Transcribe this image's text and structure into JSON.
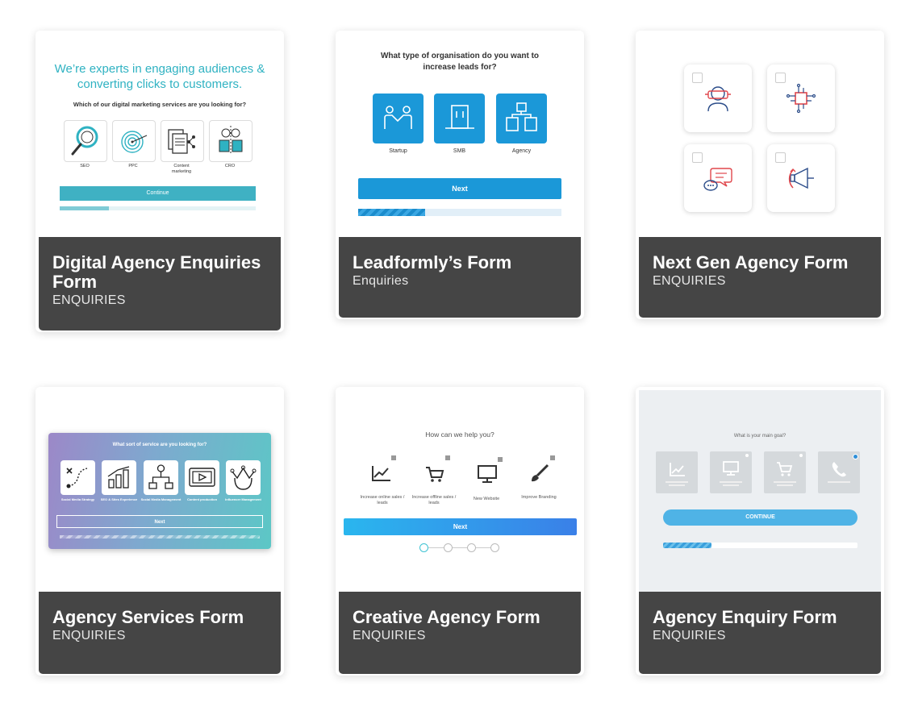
{
  "colors": {
    "caption_bg": "#454545",
    "teal": "#2fb2c2",
    "blue": "#1b98d8",
    "gray_bg": "#eceff2"
  },
  "cards": [
    {
      "title": "Digital Agency Enquiries Form",
      "subtitle": "ENQUIRIES",
      "preview": {
        "headline": "We’re experts in engaging audiences & converting clicks to customers.",
        "question": "Which of our digital marketing services are you looking for?",
        "options": [
          "SEO",
          "PPC",
          "Content marketing",
          "CRO"
        ],
        "button": "Continue",
        "progress": 0.25
      }
    },
    {
      "title": "Leadformly’s Form",
      "subtitle": "Enquiries",
      "preview": {
        "question": "What type of organisation do you want to increase leads for?",
        "options": [
          "Startup",
          "SMB",
          "Agency"
        ],
        "button": "Next",
        "progress": 0.33
      }
    },
    {
      "title": "Next Gen Agency Form",
      "subtitle": "ENQUIRIES",
      "preview": {
        "icons": [
          "vr-headset-icon",
          "circuit-chip-icon",
          "chat-bubbles-icon",
          "megaphone-icon"
        ]
      }
    },
    {
      "title": "Agency Services Form",
      "subtitle": "ENQUIRIES",
      "preview": {
        "question": "What sort of service are you looking for?",
        "options": [
          "Social Media Strategy",
          "SEO & Sites Experience",
          "Social Media Management",
          "Content production",
          "Influencer Management"
        ],
        "button": "Next"
      }
    },
    {
      "title": "Creative Agency Form",
      "subtitle": "ENQUIRIES",
      "preview": {
        "question": "How can we help you?",
        "options": [
          "Increase online sales / leads",
          "Increase offline sales / leads",
          "New Website",
          "Improve Branding"
        ],
        "button": "Next",
        "steps": 4,
        "current_step": 1
      }
    },
    {
      "title": "Agency Enquiry Form",
      "subtitle": "ENQUIRIES",
      "preview": {
        "question": "What is your main goal?",
        "button": "CONTINUE",
        "progress": 0.25
      }
    }
  ]
}
